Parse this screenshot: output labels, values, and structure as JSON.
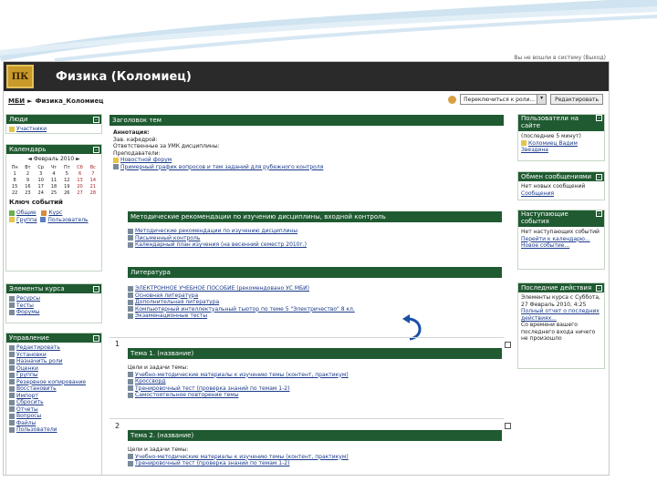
{
  "colors": {
    "header_bg": "#2a2a2a",
    "block_head": "#1f5a31",
    "logo": "#c89a2a",
    "link": "#1a3a8a"
  },
  "header": {
    "course_title": "Физика (Коломиец)",
    "top_right_text": "Вы не вошли в систему (Выход)"
  },
  "nav": {
    "breadcrumb_root": "МБИ",
    "breadcrumb_current": "Физика_Коломиец",
    "role_select": "Переключиться к роли...",
    "edit_button": "Редактировать"
  },
  "left": {
    "people": {
      "title": "Люди",
      "items": [
        "Участники"
      ]
    },
    "calendar": {
      "title": "Календарь",
      "month": "Февраль 2010",
      "weekdays": [
        "Пн",
        "Вт",
        "Ср",
        "Чт",
        "Пт",
        "Сб",
        "Вс"
      ],
      "days": [
        "1",
        "2",
        "3",
        "4",
        "5",
        "6",
        "7",
        "8",
        "9",
        "10",
        "11",
        "12",
        "13",
        "14",
        "15",
        "16",
        "17",
        "18",
        "19",
        "20",
        "21",
        "22",
        "23",
        "24",
        "25",
        "26",
        "27",
        "28"
      ]
    },
    "key": {
      "title": "Ключ событий",
      "items": [
        [
          "Общие",
          "Курс"
        ],
        [
          "Группа",
          "Пользователь"
        ]
      ]
    },
    "activities": {
      "title": "Элементы курса",
      "items": [
        "Ресурсы",
        "Тесты",
        "Форумы"
      ]
    },
    "admin": {
      "title": "Управление",
      "items": [
        "Редактировать",
        "Установки",
        "Назначить роли",
        "Оценки",
        "Группы",
        "Резервное копирование",
        "Восстановить",
        "Импорт",
        "Сбросить",
        "Отчеты",
        "Вопросы",
        "Файлы",
        "Пользователи"
      ]
    }
  },
  "center": {
    "topic0_title": "Заголовок тем",
    "topic0_items": [
      "Аннотация:",
      "Зав. кафедрой:",
      "Ответственные за УМК дисциплины:",
      "Преподаватели:",
      "Новостной форум",
      "Примерный график вопросов и тем заданий для рубежного контроля"
    ],
    "method_title": "Методические рекомендации по изучению дисциплины, входной контроль",
    "method_items": [
      "Методические рекомендации по изучению дисциплины",
      "Письменный контроль",
      "Календарный план изучения (на весенний семестр 2010г.)"
    ],
    "lit_title": "Литература",
    "lit_items": [
      "ЭЛЕКТРОННОЕ УЧЕБНОЕ ПОСОБИЕ (рекомендовано УС МБИ)",
      "Основная литература",
      "Дополнительная литература",
      "Компьютерный интеллектуальный тьютор по теме 5 \"Электричество\" 8 кл.",
      "Экзаменационные тесты"
    ],
    "topic1_num": "1",
    "topic1_title": "Тема 1. (название)",
    "topic1_items": [
      "Цели и задачи темы:",
      "Учебно-методические материалы к изучению темы (контент, практикум)",
      "Кроссворд",
      "Тренировочный тест (проверка знаний по темам 1-2)",
      "Самостоятельное повторение темы"
    ],
    "topic2_num": "2",
    "topic2_title": "Тема 2. (название)",
    "topic2_items": [
      "Цели и задачи темы:",
      "Учебно-методические материалы к изучению темы (контент, практикум)",
      "Тренировочный тест (проверка знаний по темам 1-2)"
    ]
  },
  "right": {
    "online": {
      "title": "Пользователи на сайте",
      "items": [
        "(последние 5 минут)",
        "Коломиец Вадим",
        "Звездина"
      ]
    },
    "messages": {
      "title": "Обмен сообщениями",
      "items": [
        "Нет новых сообщений",
        "Сообщения"
      ]
    },
    "upcoming": {
      "title": "Наступающие события",
      "items": [
        "Нет наступающих событий",
        "Перейти к календарю...",
        "Новое событие..."
      ]
    },
    "recent": {
      "title": "Последние действия",
      "items": [
        "Элементы курса с Суббота,",
        "27 Февраль 2010, 4:25",
        "Полный отчет о последних",
        "действиях...",
        "Со времени вашего",
        "последнего входа ничего",
        "не произошло"
      ]
    }
  }
}
